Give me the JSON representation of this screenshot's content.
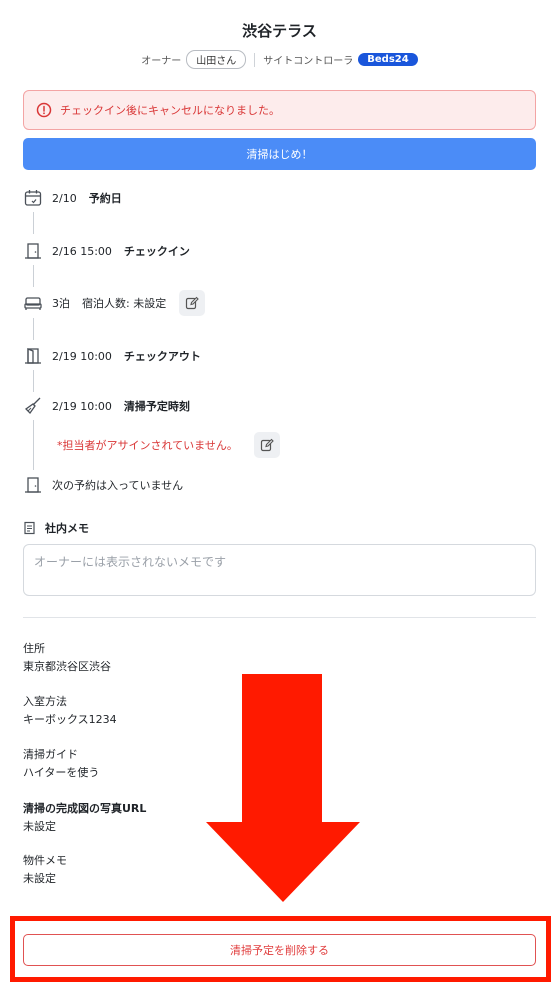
{
  "header": {
    "title": "渋谷テラス",
    "owner_label": "オーナー",
    "owner_name": "山田さん",
    "site_controller_label": "サイトコントローラ",
    "site_controller_name": "Beds24"
  },
  "alert": {
    "icon": "alert-circle-icon",
    "message": "チェックイン後にキャンセルになりました。"
  },
  "start_button": {
    "label": "清掃はじめ！"
  },
  "timeline": {
    "booking": {
      "icon": "calendar-icon",
      "date": "2/10",
      "label": "予約日"
    },
    "checkin": {
      "icon": "door-icon",
      "date": "2/16 15:00",
      "label": "チェックイン"
    },
    "stay": {
      "icon": "bed-icon",
      "nights": "3泊",
      "guests": "宿泊人数: 未設定"
    },
    "checkout": {
      "icon": "door-open-icon",
      "date": "2/19 10:00",
      "label": "チェックアウト"
    },
    "cleaning": {
      "icon": "broom-icon",
      "date": "2/19 10:00",
      "label": "清掃予定時刻",
      "unassigned": "*担当者がアサインされていません。"
    },
    "next": {
      "icon": "door-icon",
      "label": "次の予約は入っていません"
    }
  },
  "memo": {
    "title": "社内メモ",
    "placeholder": "オーナーには表示されないメモです"
  },
  "info": [
    {
      "label": "住所",
      "value": "東京都渋谷区渋谷"
    },
    {
      "label": "入室方法",
      "value": "キーボックス1234"
    },
    {
      "label": "清掃ガイド",
      "value": "ハイターを使う"
    },
    {
      "label": "清掃の完成図の写真URL",
      "value": "未設定"
    },
    {
      "label": "物件メモ",
      "value": "未設定"
    }
  ],
  "delete_button": {
    "label": "清掃予定を削除する"
  },
  "colors": {
    "primary": "#4b8cf7",
    "danger": "#d93636",
    "beds24": "#1a56db",
    "annotation_red": "#ff1a00"
  }
}
